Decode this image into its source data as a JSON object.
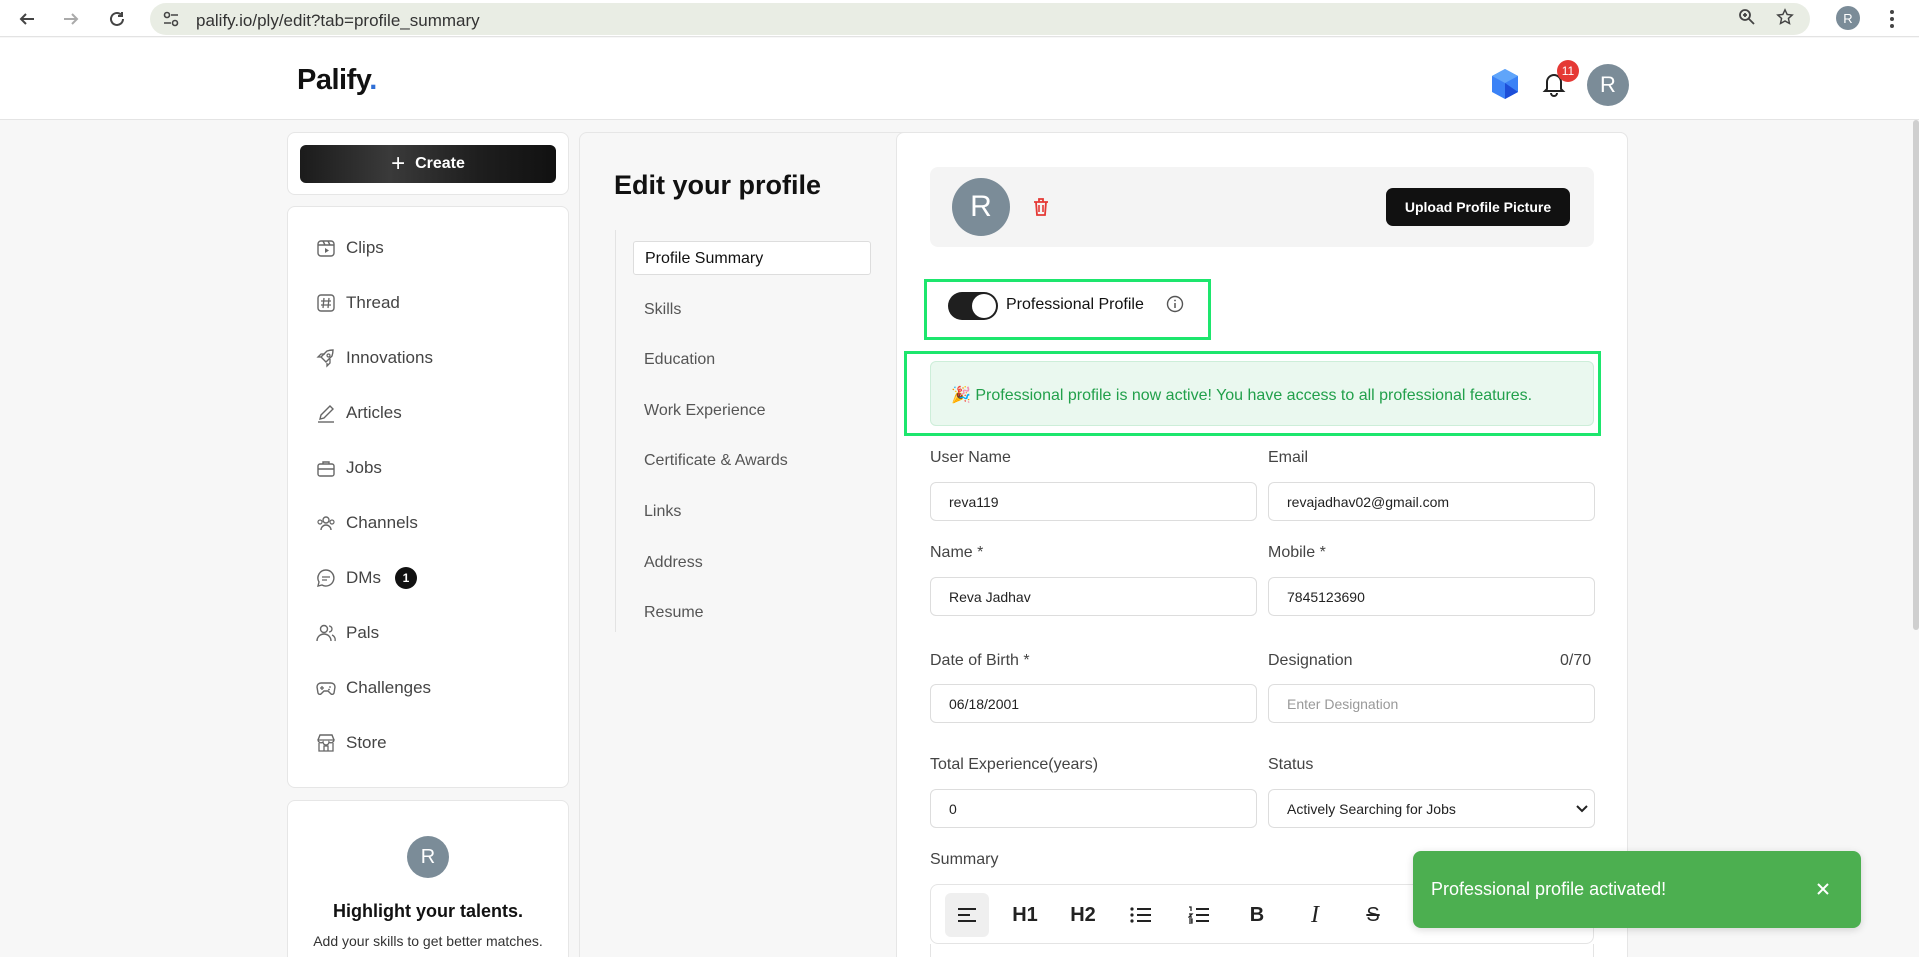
{
  "browser": {
    "url": "palify.io/ply/edit?tab=profile_summary",
    "profile_initial": "R"
  },
  "header": {
    "logo_text": "Palify",
    "logo_dot": ".",
    "notification_count": "11",
    "avatar_initial": "R"
  },
  "sidebar": {
    "create_label": "Create",
    "items": [
      {
        "label": "Clips",
        "icon": "clips-icon"
      },
      {
        "label": "Thread",
        "icon": "hashtag-icon"
      },
      {
        "label": "Innovations",
        "icon": "rocket-icon"
      },
      {
        "label": "Articles",
        "icon": "pencil-icon"
      },
      {
        "label": "Jobs",
        "icon": "briefcase-icon"
      },
      {
        "label": "Channels",
        "icon": "people-group-icon"
      },
      {
        "label": "DMs",
        "icon": "chat-icon",
        "badge": "1"
      },
      {
        "label": "Pals",
        "icon": "users-icon"
      },
      {
        "label": "Challenges",
        "icon": "gamepad-icon"
      },
      {
        "label": "Store",
        "icon": "store-icon"
      }
    ],
    "promo": {
      "avatar_initial": "R",
      "title": "Highlight your talents.",
      "subtitle": "Add your skills to get better matches."
    }
  },
  "main": {
    "title": "Edit your profile",
    "tabs": [
      {
        "label": "Profile Summary",
        "active": true
      },
      {
        "label": "Skills"
      },
      {
        "label": "Education"
      },
      {
        "label": "Work Experience"
      },
      {
        "label": "Certificate & Awards"
      },
      {
        "label": "Links"
      },
      {
        "label": "Address"
      },
      {
        "label": "Resume"
      }
    ],
    "profile_pic": {
      "avatar_initial": "R",
      "upload_label": "Upload Profile Picture"
    },
    "professional_toggle": {
      "label": "Professional Profile",
      "on": true
    },
    "alert_text": "🎉 Professional profile is now active! You have access to all professional features.",
    "form": {
      "username": {
        "label": "User Name",
        "value": "reva119"
      },
      "email": {
        "label": "Email",
        "value": "revajadhav02@gmail.com"
      },
      "name": {
        "label": "Name *",
        "value": "Reva Jadhav"
      },
      "mobile": {
        "label": "Mobile *",
        "value": "7845123690"
      },
      "dob": {
        "label": "Date of Birth *",
        "value": "06/18/2001"
      },
      "designation": {
        "label": "Designation",
        "placeholder": "Enter Designation",
        "counter": "0/70"
      },
      "experience": {
        "label": "Total Experience(years)",
        "value": "0"
      },
      "status": {
        "label": "Status",
        "value": "Actively Searching for Jobs"
      },
      "summary": {
        "label": "Summary"
      }
    },
    "toolbar": {
      "h1": "H1",
      "h2": "H2",
      "bold": "B",
      "italic": "I",
      "strike": "S"
    }
  },
  "toast": {
    "text": "Professional profile activated!"
  },
  "colors": {
    "accent": "#2f6fd6",
    "highlight": "#1de66d",
    "success_text": "#22a04b",
    "toast_bg": "#4caf50",
    "badge_red": "#e53935"
  }
}
